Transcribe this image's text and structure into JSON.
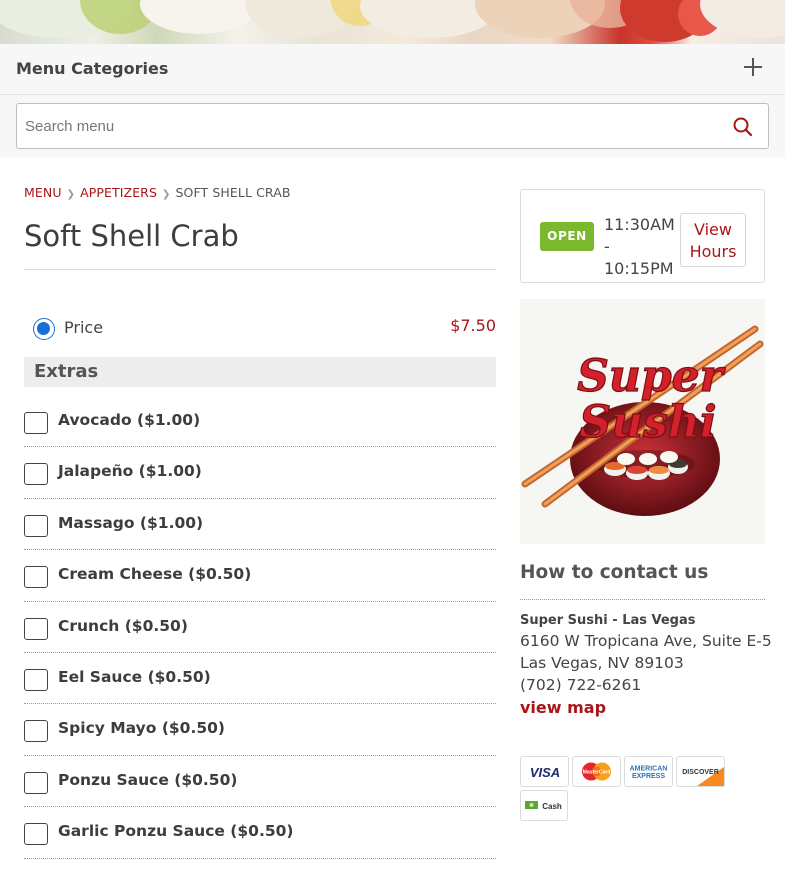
{
  "menu_categories": {
    "title": "Menu Categories"
  },
  "search": {
    "placeholder": "Search menu"
  },
  "breadcrumb": {
    "items": [
      "MENU",
      "APPETIZERS"
    ],
    "current": "SOFT SHELL CRAB"
  },
  "item": {
    "title": "Soft Shell Crab",
    "price_label": "Price",
    "price_value": "$7.50"
  },
  "extras": {
    "heading": "Extras",
    "options": [
      "Avocado ($1.00)",
      "Jalapeño ($1.00)",
      "Massago ($1.00)",
      "Cream Cheese ($0.50)",
      "Crunch ($0.50)",
      "Eel Sauce ($0.50)",
      "Spicy Mayo ($0.50)",
      "Ponzu Sauce ($0.50)",
      "Garlic Ponzu Sauce ($0.50)"
    ]
  },
  "hours": {
    "status": "OPEN",
    "range_start": "11:30AM -",
    "range_end": "10:15PM",
    "view_label_1": "View",
    "view_label_2": "Hours"
  },
  "logo": {
    "line1": "Super",
    "line2": "Sushi"
  },
  "contact": {
    "title": "How to contact us",
    "name": "Super Sushi - Las Vegas",
    "address1": "6160 W Tropicana Ave, Suite E-5",
    "address2": "Las Vegas, NV 89103",
    "phone": "(702) 722-6261",
    "map_link": "view map"
  },
  "payments": {
    "visa": "VISA",
    "mastercard": "MasterCard",
    "amex_1": "AMERICAN",
    "amex_2": "EXPRESS",
    "discover": "DISCOVER",
    "cash": "Cash"
  },
  "colors": {
    "brand_red": "#a8161a",
    "open_green": "#7cb82f",
    "radio_blue": "#1a6fd6"
  }
}
